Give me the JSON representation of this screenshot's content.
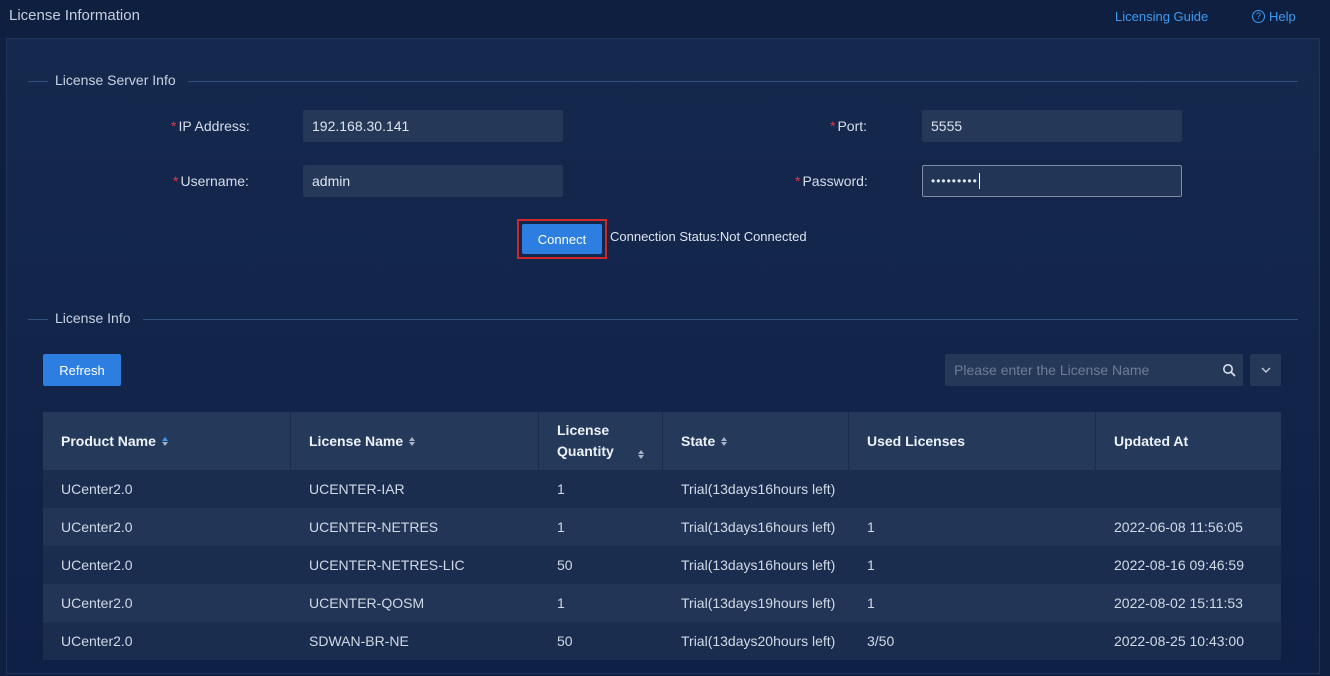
{
  "header": {
    "title": "License Information",
    "guide_link": "Licensing Guide",
    "help_link": "Help"
  },
  "server_section": {
    "title": "License Server Info",
    "ip_label": "IP Address:",
    "ip_value": "192.168.30.141",
    "port_label": "Port:",
    "port_value": "5555",
    "username_label": "Username:",
    "username_value": "admin",
    "password_label": "Password:",
    "password_mask": "•••••••••",
    "connect_label": "Connect",
    "status_text": "Connection Status:Not Connected"
  },
  "license_section": {
    "title": "License Info",
    "refresh_label": "Refresh",
    "search_placeholder": "Please enter the License Name"
  },
  "table": {
    "columns": [
      {
        "label": "Product Name",
        "sortable": true
      },
      {
        "label": "License Name",
        "sortable": true
      },
      {
        "label": "License Quantity",
        "sortable": true
      },
      {
        "label": "State",
        "sortable": true
      },
      {
        "label": "Used Licenses",
        "sortable": false
      },
      {
        "label": "Updated At",
        "sortable": false
      }
    ],
    "rows": [
      [
        "UCenter2.0",
        "UCENTER-IAR",
        "1",
        "Trial(13days16hours left)",
        "",
        ""
      ],
      [
        "UCenter2.0",
        "UCENTER-NETRES",
        "1",
        "Trial(13days16hours left)",
        "1",
        "2022-06-08 11:56:05"
      ],
      [
        "UCenter2.0",
        "UCENTER-NETRES-LIC",
        "50",
        "Trial(13days16hours left)",
        "1",
        "2022-08-16 09:46:59"
      ],
      [
        "UCenter2.0",
        "UCENTER-QOSM",
        "1",
        "Trial(13days19hours left)",
        "1",
        "2022-08-02 15:11:53"
      ],
      [
        "UCenter2.0",
        "SDWAN-BR-NE",
        "50",
        "Trial(13days20hours left)",
        "3/50",
        "2022-08-25 10:43:00"
      ]
    ]
  },
  "colors": {
    "accent": "#2c7fe0",
    "link": "#3d9bf2",
    "required": "#e0394a",
    "highlight_border": "#d02828"
  },
  "icons": [
    "help-circle-icon",
    "search-icon",
    "chevron-down-icon",
    "sort-icon"
  ]
}
